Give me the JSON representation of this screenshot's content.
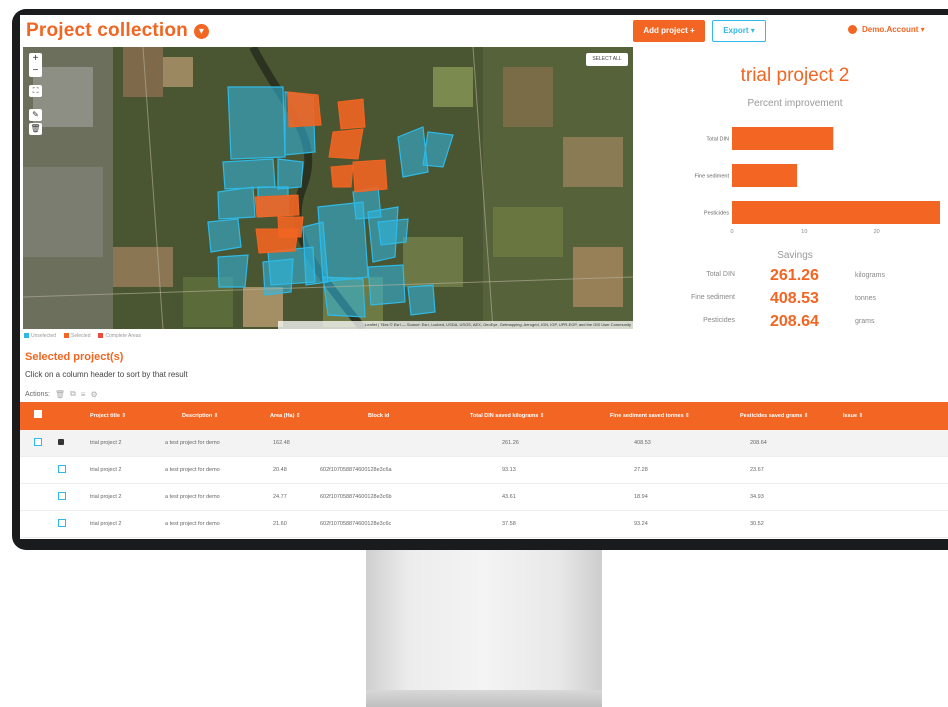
{
  "header": {
    "title": "Project collection",
    "add_project_label": "Add project +",
    "export_label": "Export ▾",
    "account_label": "Demo.Account ▾"
  },
  "map": {
    "zoom_in": "+",
    "zoom_out": "−",
    "select_all": "SELECT ALL",
    "attribution": "Leaflet | Tiles © Esri — Source: Esri, i-cubed, USDA, USGS, AEX, GeoEye, Getmapping, Aerogrid, IGN, IGP, UPR-EGP, and the GIS User Community",
    "legend": [
      {
        "label": "Unselected",
        "color": "#30b9e6"
      },
      {
        "label": "Selected",
        "color": "#f26522"
      },
      {
        "label": "Complete Areas",
        "color": "#e74c3c"
      }
    ]
  },
  "panel": {
    "project_name": "trial project 2",
    "chart_title": "Percent improvement",
    "savings_title": "Savings",
    "savings": [
      {
        "label": "Total DIN",
        "value": "261.26",
        "unit": "kilograms"
      },
      {
        "label": "Fine sediment",
        "value": "408.53",
        "unit": "tonnes"
      },
      {
        "label": "Pesticides",
        "value": "208.64",
        "unit": "grams"
      }
    ]
  },
  "chart_data": {
    "type": "bar",
    "orientation": "horizontal",
    "title": "Percent improvement",
    "categories": [
      "Total DIN",
      "Fine sediment",
      "Pesticides"
    ],
    "values": [
      14,
      9,
      30
    ],
    "xlim": [
      0,
      30
    ],
    "xticks": [
      0,
      10,
      20,
      30
    ],
    "color": "#f26522"
  },
  "selected": {
    "title": "Selected project(s)",
    "hint": "Click on a column header to sort by that result",
    "actions_label": "Actions:"
  },
  "table": {
    "columns": [
      "Project title ⇕",
      "Description ⇕",
      "Area (Ha) ⇕",
      "Block id",
      "Total DIN saved kilograms ⇕",
      "Fine sediment saved tonnes ⇕",
      "Pesticides saved grams ⇕",
      "Issue ⇕"
    ],
    "rows": [
      [
        "trial project 2",
        "a test project for demo",
        "162.48",
        "",
        "261.26",
        "408.53",
        "208.64",
        ""
      ],
      [
        "trial project 2",
        "a test project for demo",
        "20.48",
        "602f107058874600128e3c6a",
        "93.13",
        "27.28",
        "23.67",
        ""
      ],
      [
        "trial project 2",
        "a test project for demo",
        "24.77",
        "602f107058874600128e3c6b",
        "43.61",
        "18.94",
        "34.93",
        ""
      ],
      [
        "trial project 2",
        "a test project for demo",
        "21.60",
        "602f107058874600128e3c6c",
        "37.58",
        "93.24",
        "30.52",
        ""
      ]
    ]
  }
}
